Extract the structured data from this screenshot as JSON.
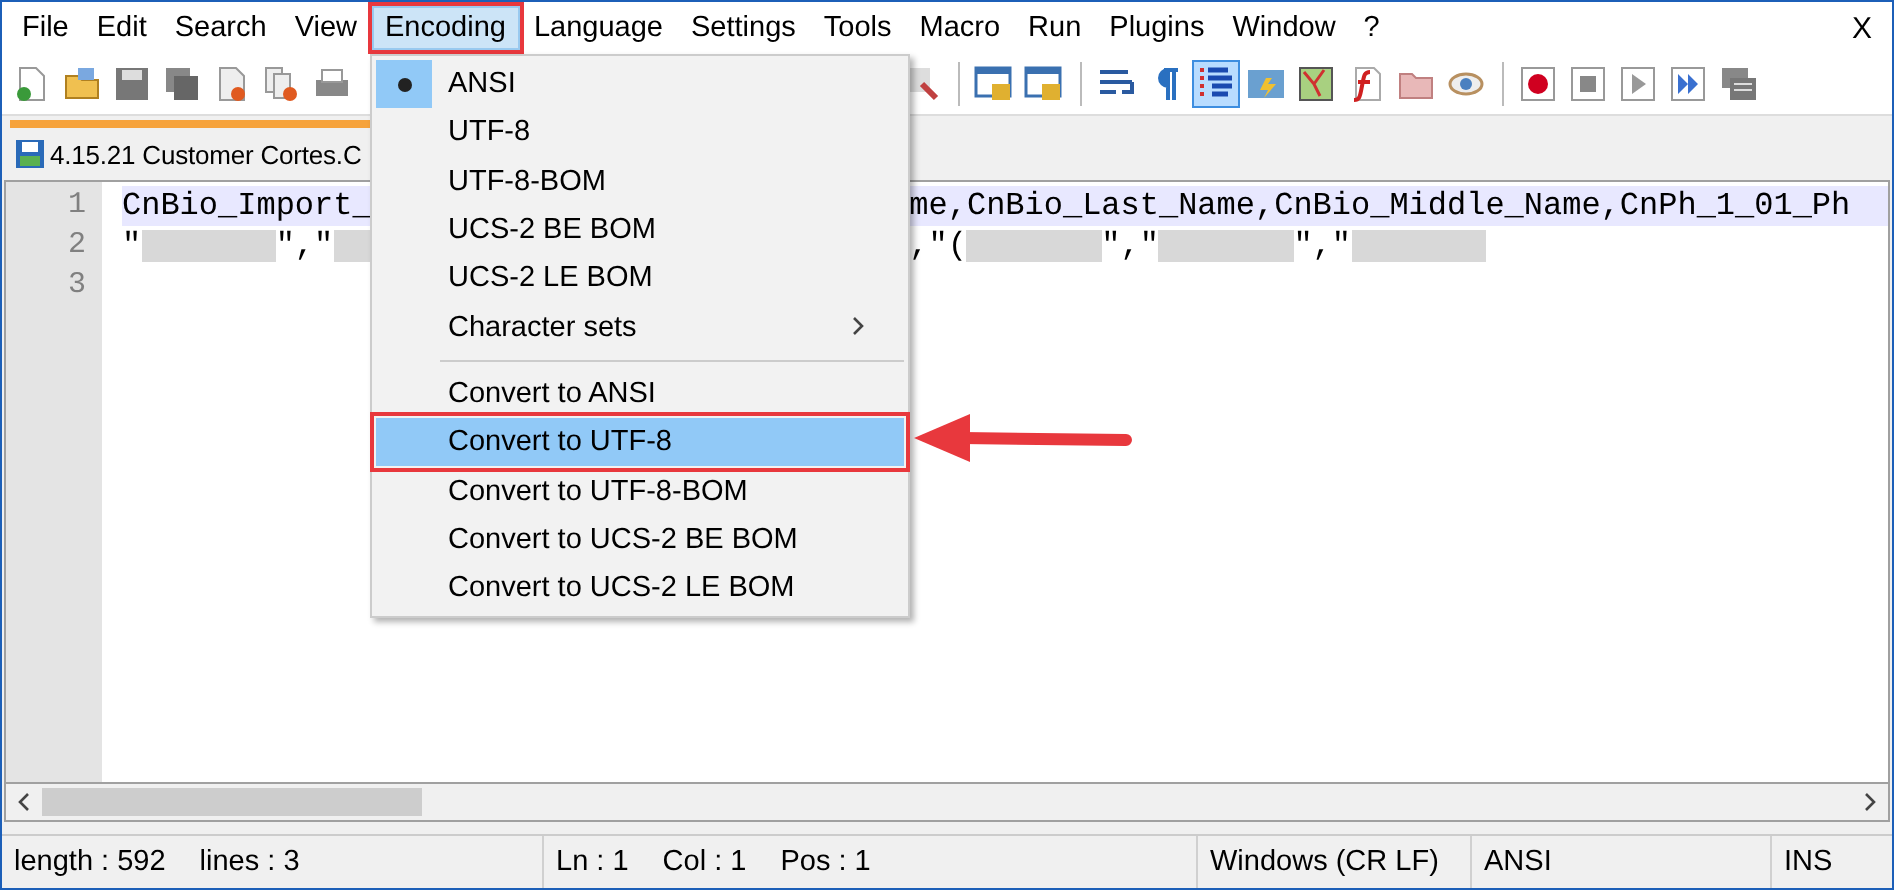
{
  "menu_bar": [
    {
      "label": "File",
      "selected": false
    },
    {
      "label": "Edit",
      "selected": false
    },
    {
      "label": "Search",
      "selected": false
    },
    {
      "label": "View",
      "selected": false
    },
    {
      "label": "Encoding",
      "selected": true,
      "annotated": true
    },
    {
      "label": "Language",
      "selected": false
    },
    {
      "label": "Settings",
      "selected": false
    },
    {
      "label": "Tools",
      "selected": false
    },
    {
      "label": "Macro",
      "selected": false
    },
    {
      "label": "Run",
      "selected": false
    },
    {
      "label": "Plugins",
      "selected": false
    },
    {
      "label": "Window",
      "selected": false
    },
    {
      "label": "?",
      "selected": false
    }
  ],
  "close_label": "X",
  "toolbar_left": [
    {
      "kind": "new",
      "selected": false
    },
    {
      "kind": "open",
      "selected": false
    },
    {
      "kind": "save",
      "selected": false
    },
    {
      "kind": "saveall",
      "selected": false
    },
    {
      "kind": "close",
      "selected": false
    },
    {
      "kind": "closeall",
      "selected": false
    },
    {
      "kind": "print",
      "selected": false
    }
  ],
  "toolbar_right": [
    {
      "kind": "zoom",
      "selected": false
    },
    {
      "kind": "separator"
    },
    {
      "kind": "lockwin",
      "selected": false
    },
    {
      "kind": "lockwin",
      "selected": false
    },
    {
      "kind": "separator"
    },
    {
      "kind": "wrap",
      "selected": false
    },
    {
      "kind": "pilcrow",
      "selected": false
    },
    {
      "kind": "indent",
      "selected": true
    },
    {
      "kind": "panel",
      "selected": false
    },
    {
      "kind": "map",
      "selected": false
    },
    {
      "kind": "function",
      "selected": false
    },
    {
      "kind": "folder",
      "selected": false
    },
    {
      "kind": "eye",
      "selected": false
    },
    {
      "kind": "separator"
    },
    {
      "kind": "record",
      "selected": false
    },
    {
      "kind": "stop",
      "selected": false
    },
    {
      "kind": "play",
      "selected": false
    },
    {
      "kind": "playmulti",
      "selected": false
    },
    {
      "kind": "savemacro",
      "selected": false
    }
  ],
  "tabs": [
    {
      "label": "4.15.21 Customer Cortes.C",
      "selected": true
    }
  ],
  "editor": {
    "lines": [
      {
        "number": "1",
        "current": true,
        "segments": [
          {
            "kind": "text",
            "text": "CnBio_Import_"
          },
          {
            "kind": "hidden"
          },
          {
            "kind": "text",
            "text": "me,CnBio_Last_Name,CnBio_Middle_Name,CnPh_1_01_Ph"
          }
        ]
      },
      {
        "number": "2",
        "current": false,
        "segments": [
          {
            "kind": "text",
            "text": "\""
          },
          {
            "kind": "redacted"
          },
          {
            "kind": "text",
            "text": "\",\""
          },
          {
            "kind": "redacted"
          },
          {
            "kind": "hidden"
          },
          {
            "kind": "text",
            "text": ",\"("
          },
          {
            "kind": "redacted"
          },
          {
            "kind": "text",
            "text": "\",\""
          },
          {
            "kind": "redacted"
          },
          {
            "kind": "text",
            "text": "\",\""
          },
          {
            "kind": "redacted"
          }
        ]
      },
      {
        "number": "3",
        "current": false
      }
    ]
  },
  "encoding_menu": [
    {
      "kind": "item",
      "label": "ANSI",
      "checked": true,
      "selected": false
    },
    {
      "kind": "item",
      "label": "UTF-8",
      "checked": false,
      "selected": false
    },
    {
      "kind": "item",
      "label": "UTF-8-BOM",
      "checked": false,
      "selected": false
    },
    {
      "kind": "item",
      "label": "UCS-2 BE BOM",
      "checked": false,
      "selected": false
    },
    {
      "kind": "item",
      "label": "UCS-2 LE BOM",
      "checked": false,
      "selected": false
    },
    {
      "kind": "submenu",
      "label": "Character sets",
      "selected": false
    },
    {
      "kind": "separator"
    },
    {
      "kind": "item",
      "label": "Convert to ANSI",
      "checked": false,
      "selected": false
    },
    {
      "kind": "item",
      "label": "Convert to UTF-8",
      "checked": false,
      "selected": true,
      "annotated": true
    },
    {
      "kind": "item",
      "label": "Convert to UTF-8-BOM",
      "checked": false,
      "selected": false
    },
    {
      "kind": "item",
      "label": "Convert to UCS-2 BE BOM",
      "checked": false,
      "selected": false
    },
    {
      "kind": "item",
      "label": "Convert to UCS-2 LE BOM",
      "checked": false,
      "selected": false
    }
  ],
  "status_bar": [
    {
      "texts": [
        "length : 592",
        "lines : 3"
      ]
    },
    {
      "texts": [
        "Ln : 1",
        "Col : 1",
        "Pos : 1"
      ]
    },
    {
      "texts": [
        "Windows (CR LF)"
      ]
    },
    {
      "texts": [
        "ANSI"
      ]
    },
    {
      "texts": [
        "INS"
      ]
    }
  ]
}
